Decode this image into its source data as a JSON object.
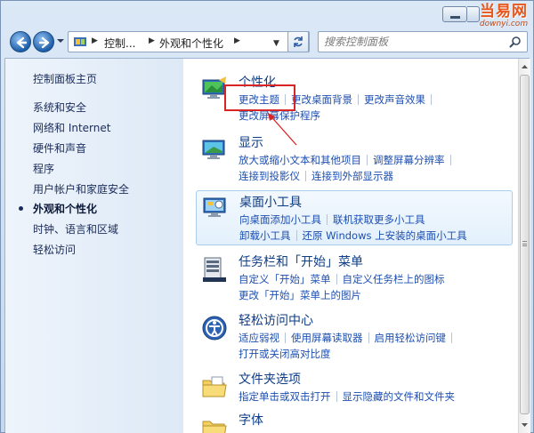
{
  "logo": {
    "text_cn": "当易网",
    "text_en": "downyi.com"
  },
  "nav": {
    "breadcrumbs": [
      "控制...",
      "外观和个性化"
    ],
    "search_placeholder": "搜索控制面板"
  },
  "sidebar": {
    "items": [
      {
        "label": "控制面板主页",
        "active": false
      },
      {
        "label": "系统和安全",
        "active": false
      },
      {
        "label": "网络和 Internet",
        "active": false
      },
      {
        "label": "硬件和声音",
        "active": false
      },
      {
        "label": "程序",
        "active": false
      },
      {
        "label": "用户帐户和家庭安全",
        "active": false
      },
      {
        "label": "外观和个性化",
        "active": true
      },
      {
        "label": "时钟、语言和区域",
        "active": false
      },
      {
        "label": "轻松访问",
        "active": false
      }
    ]
  },
  "categories": [
    {
      "title": "个性化",
      "icon": "personalization-icon",
      "rows": [
        [
          "更改主题",
          "更改桌面背景",
          "更改声音效果"
        ],
        [
          "更改屏幕保护程序"
        ]
      ]
    },
    {
      "title": "显示",
      "icon": "display-icon",
      "rows": [
        [
          "放大或缩小文本和其他项目",
          "调整屏幕分辨率"
        ],
        [
          "连接到投影仪",
          "连接到外部显示器"
        ]
      ]
    },
    {
      "title": "桌面小工具",
      "icon": "gadgets-icon",
      "rows": [
        [
          "向桌面添加小工具",
          "联机获取更多小工具"
        ],
        [
          "卸载小工具",
          "还原 Windows 上安装的桌面小工具"
        ]
      ]
    },
    {
      "title": "任务栏和「开始」菜单",
      "icon": "taskbar-icon",
      "rows": [
        [
          "自定义「开始」菜单",
          "自定义任务栏上的图标"
        ],
        [
          "更改「开始」菜单上的图片"
        ]
      ]
    },
    {
      "title": "轻松访问中心",
      "icon": "ease-of-access-icon",
      "rows": [
        [
          "适应弱视",
          "使用屏幕读取器",
          "启用轻松访问键"
        ],
        [
          "打开或关闭高对比度"
        ]
      ]
    },
    {
      "title": "文件夹选项",
      "icon": "folder-options-icon",
      "rows": [
        [
          "指定单击或双击打开",
          "显示隐藏的文件和文件夹"
        ]
      ]
    },
    {
      "title": "字体",
      "icon": "fonts-icon",
      "rows": []
    }
  ],
  "colors": {
    "link": "#1c4fb1",
    "title": "#0e3d85",
    "annotation": "#d92424"
  }
}
